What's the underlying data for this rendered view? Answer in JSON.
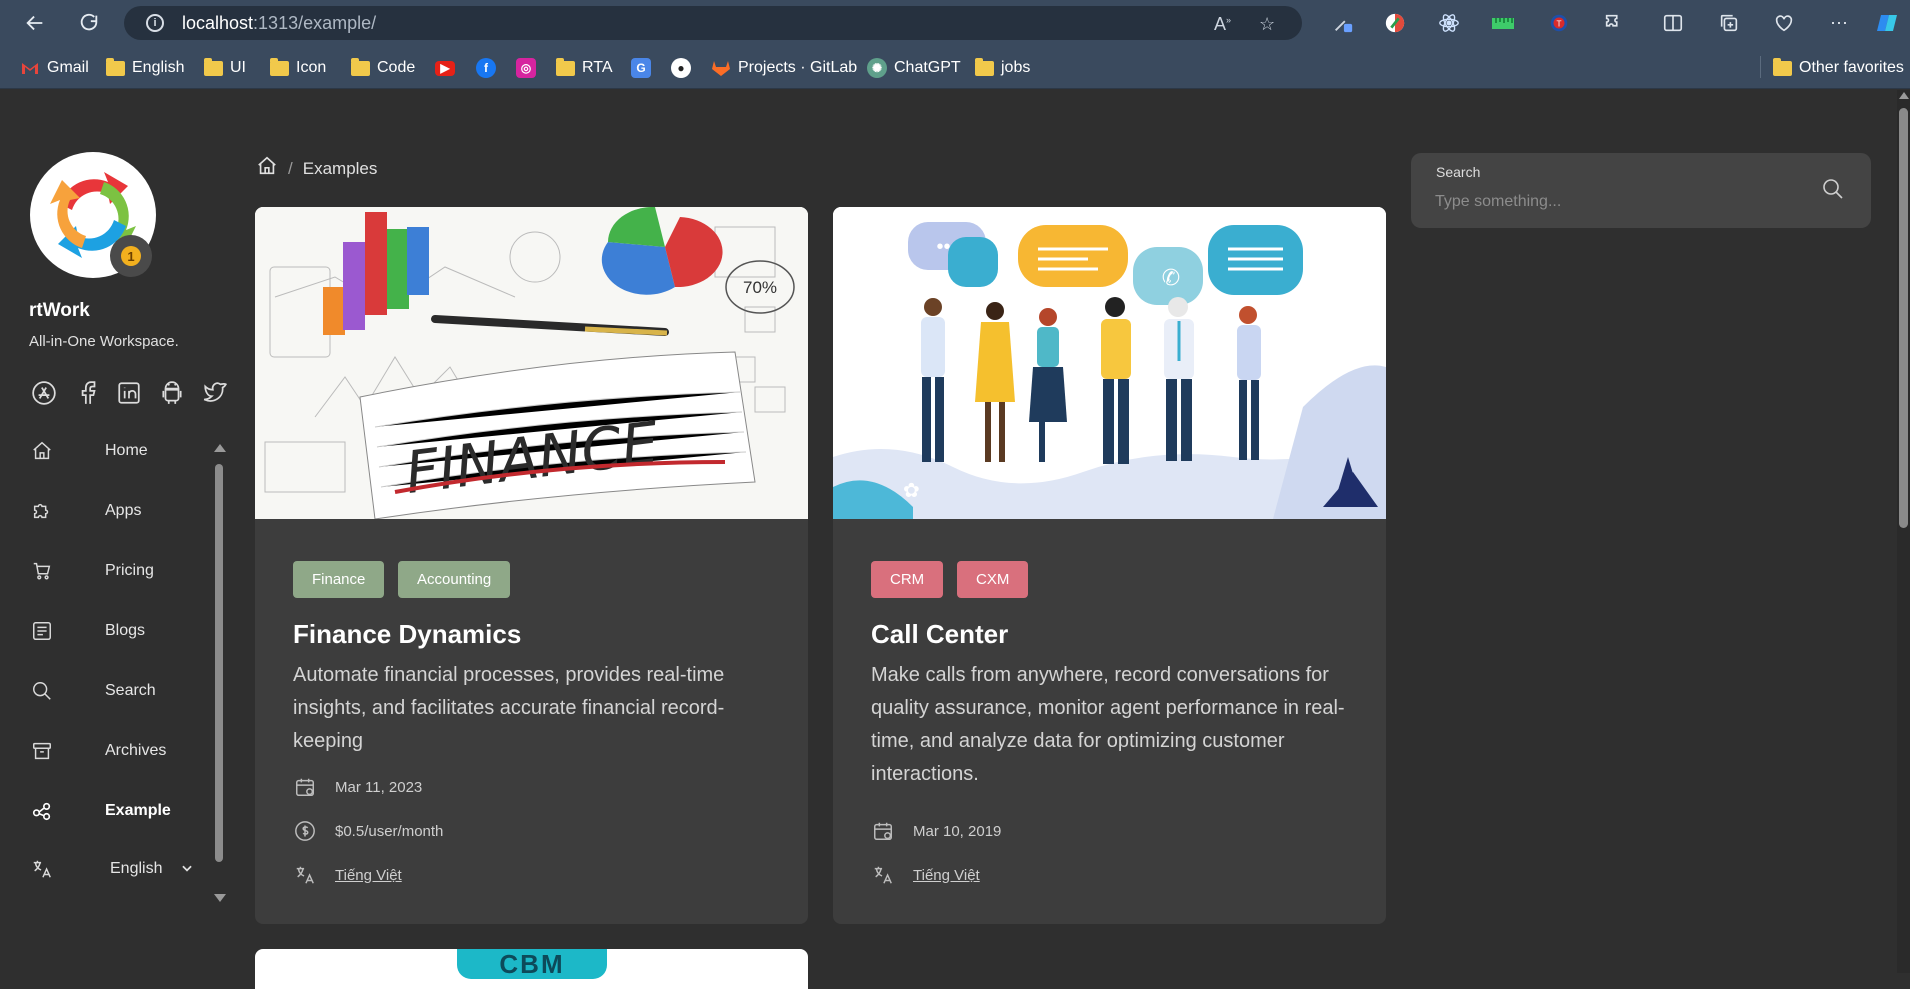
{
  "browser": {
    "url_host": "localhost",
    "url_path": ":1313/example/",
    "bookmarks": [
      {
        "label": "Gmail",
        "icon": "gmail-icon"
      },
      {
        "label": "English",
        "icon": "folder-icon"
      },
      {
        "label": "UI",
        "icon": "folder-icon"
      },
      {
        "label": "Icon",
        "icon": "folder-icon"
      },
      {
        "label": "Code",
        "icon": "folder-icon"
      },
      {
        "label": "",
        "icon": "youtube-icon"
      },
      {
        "label": "",
        "icon": "facebook-icon"
      },
      {
        "label": "",
        "icon": "instagram-icon"
      },
      {
        "label": "RTA",
        "icon": "folder-icon"
      },
      {
        "label": "",
        "icon": "translate-icon"
      },
      {
        "label": "",
        "icon": "github-icon"
      },
      {
        "label": "Projects · GitLab",
        "icon": "gitlab-icon"
      },
      {
        "label": "ChatGPT",
        "icon": "chatgpt-icon"
      },
      {
        "label": "jobs",
        "icon": "folder-icon"
      }
    ],
    "other_favorites": "Other favorites"
  },
  "sidebar": {
    "site_name": "rtWork",
    "tagline": "All-in-One Workspace.",
    "social": [
      "app-store-icon",
      "facebook-icon",
      "linkedin-icon",
      "android-icon",
      "twitter-icon"
    ],
    "menu": [
      {
        "label": "Home",
        "icon": "home-icon",
        "active": false
      },
      {
        "label": "Apps",
        "icon": "puzzle-icon",
        "active": false
      },
      {
        "label": "Pricing",
        "icon": "cart-icon",
        "active": false
      },
      {
        "label": "Blogs",
        "icon": "blog-icon",
        "active": false
      },
      {
        "label": "Search",
        "icon": "search-icon",
        "active": false
      },
      {
        "label": "Archives",
        "icon": "archive-icon",
        "active": false
      },
      {
        "label": "Example",
        "icon": "example-icon",
        "active": true
      },
      {
        "label": "English",
        "icon": "language-icon",
        "active": false
      }
    ]
  },
  "breadcrumb": {
    "separator": "/",
    "current": "Examples"
  },
  "search": {
    "label": "Search",
    "placeholder": "Type something..."
  },
  "cards": [
    {
      "tags": [
        "Finance",
        "Accounting"
      ],
      "title": "Finance Dynamics",
      "description": "Automate financial processes, provides real-time insights, and facilitates accurate financial record-keeping",
      "date": "Mar 11, 2023",
      "price": "$0.5/user/month",
      "language": "Tiếng Việt",
      "hero_text": "FINANCE",
      "hero_percent": "70%"
    },
    {
      "tags": [
        "CRM",
        "CXM"
      ],
      "title": "Call Center",
      "description": "Make calls from anywhere, record conversations for quality assurance, monitor agent performance in real-time, and analyze data for optimizing customer interactions.",
      "date": "Mar 10, 2019",
      "language": "Tiếng Việt"
    }
  ],
  "third_card": {
    "hero_text": "CBM"
  },
  "colors": {
    "background": "#2f2f2f",
    "card": "#3d3d3d",
    "tag_green": "#8fa888",
    "tag_red": "#d9707d"
  }
}
